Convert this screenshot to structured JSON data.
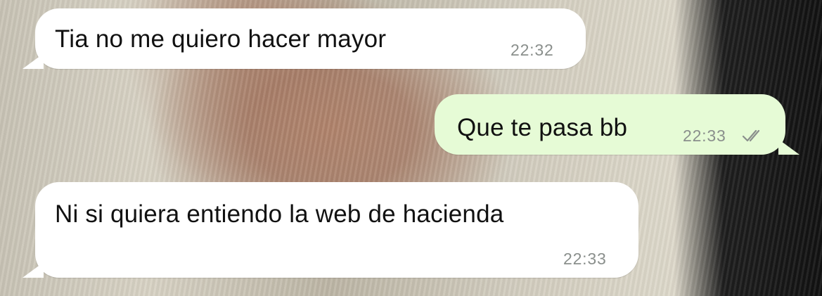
{
  "chat": {
    "messages": [
      {
        "direction": "incoming",
        "text": "Tia no me quiero hacer mayor",
        "time": "22:32"
      },
      {
        "direction": "outgoing",
        "text": "Que te pasa bb",
        "time": "22:33",
        "status_icon": "double-check-icon"
      },
      {
        "direction": "incoming",
        "text": "Ni si quiera entiendo la web de hacienda",
        "time": "22:33"
      }
    ]
  },
  "colors": {
    "incoming_bubble": "#ffffff",
    "outgoing_bubble": "#e6fbd6",
    "timestamp": "#8a8f8c",
    "read_ticks": "#8a8f8c"
  }
}
